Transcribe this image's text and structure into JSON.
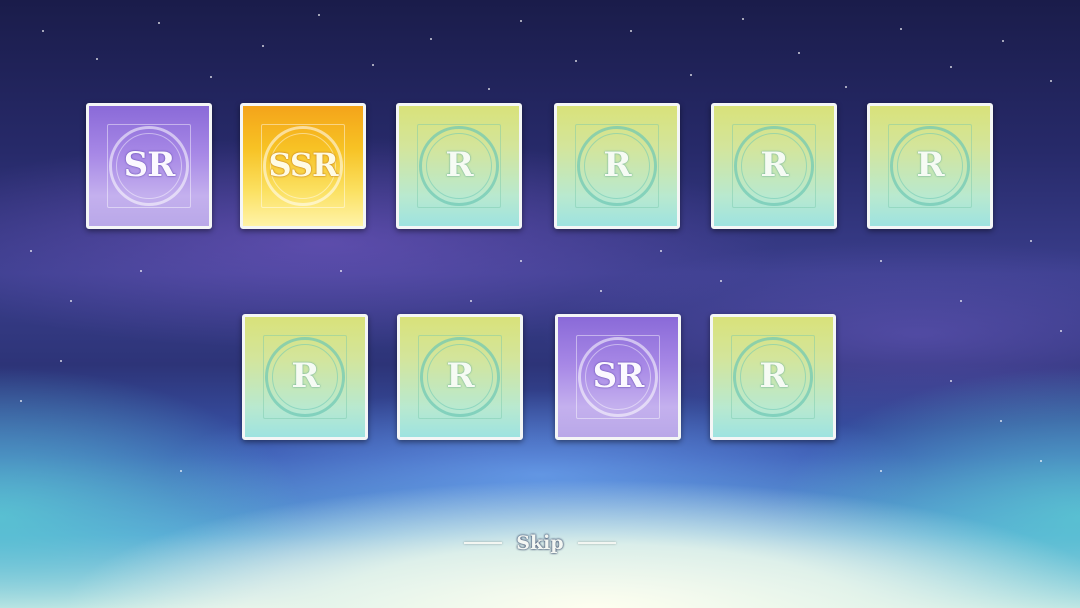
{
  "cards": [
    {
      "rarity": "SR"
    },
    {
      "rarity": "SSR"
    },
    {
      "rarity": "R"
    },
    {
      "rarity": "R"
    },
    {
      "rarity": "R"
    },
    {
      "rarity": "R"
    },
    {
      "rarity": "R"
    },
    {
      "rarity": "R"
    },
    {
      "rarity": "SR"
    },
    {
      "rarity": "R"
    }
  ],
  "skip_label": "Skip",
  "colors": {
    "r_card": "#cfe3a0",
    "sr_card": "#a788e6",
    "ssr_card": "#f7c224",
    "card_border": "#f4f6f6"
  }
}
